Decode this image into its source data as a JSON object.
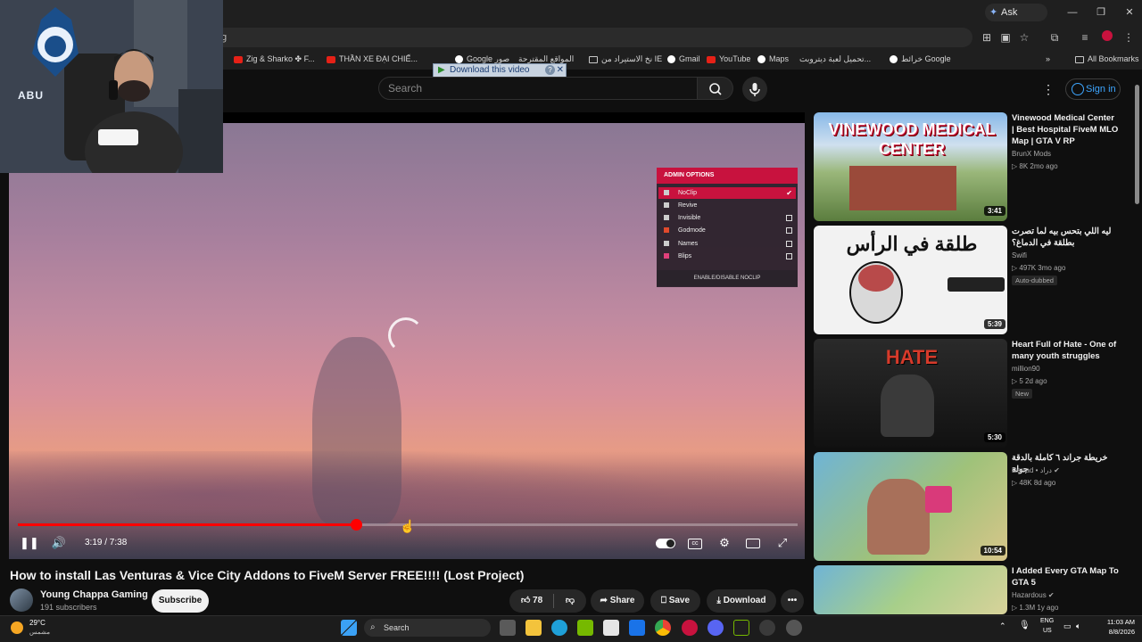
{
  "browser": {
    "ask_gemini": "Ask Gemini",
    "address_fragment": "g",
    "bookmarks": [
      "Zig & Sharko ✤ F...",
      "THẦN XE ĐẠI CHIẾ...",
      "Google صور",
      "المواقع المقترحة",
      "تحميل لعبة ديتروبت...",
      "Maps",
      "YouTube",
      "Gmail",
      "نخ الاستيراد من IE",
      "خرائط Google",
      "All Bookmarks"
    ],
    "download_bar": "Download this video"
  },
  "youtube": {
    "search_placeholder": "Search",
    "signin_label": "Sign in"
  },
  "video": {
    "admin_title": "ADMIN OPTIONS",
    "admin_items": [
      "NoClip",
      "Revive",
      "Invisible",
      "Godmode",
      "Names",
      "Blips"
    ],
    "admin_button": "ENABLE/DISABLE NOCLIP",
    "time": "3:19 / 7:38",
    "progress_fraction": 0.434,
    "title": "How to install Las Venturas & Vice City Addons to FiveM Server FREE!!!! (Lost Project)"
  },
  "channel": {
    "name": "Young Chappa Gaming",
    "subscribers": "191 subscribers",
    "subscribe_label": "Subscribe"
  },
  "actions": {
    "likes": "78",
    "share": "Share",
    "save": "Save",
    "download": "Download"
  },
  "recommendations": [
    {
      "title": "Vinewood Medical Center | Best Hospital FiveM MLO Map | GTA V RP",
      "channel": "BrunX Mods",
      "meta": "8K  2mo ago",
      "duration": "3:41",
      "badge": ""
    },
    {
      "title": "ليه اللي بتحس بيه لما تصرت بطلقة في الدماغ؟",
      "channel": "Swifi",
      "meta": "497K  3mo ago",
      "duration": "5:39",
      "badge": "Auto-dubbed"
    },
    {
      "title": "Heart Full of Hate - One of many youth struggles",
      "channel": "million90",
      "meta": "5  2d ago",
      "duration": "5:30",
      "badge": "New"
    },
    {
      "title": "خريطة جراند ٦ كاملة بالدقة جولة",
      "channel": "Derrad • دراد",
      "meta": "48K  8d ago",
      "duration": "10:54",
      "badge": ""
    },
    {
      "title": "I Added Every GTA Map To GTA 5",
      "channel": "Hazardous",
      "meta": "1.3M  1y ago",
      "duration": "",
      "badge": ""
    }
  ],
  "thumb_texts": {
    "vinewood": "VINEWOOD MEDICAL CENTER",
    "arabic": "طلقة في الرأس",
    "hate": "HATE"
  },
  "taskbar": {
    "temperature": "29°C",
    "condition": "مشمس",
    "search": "Search",
    "lang1": "ENG",
    "lang2": "US",
    "time": "11:03 AM",
    "date": "8/8/2026"
  },
  "webcam_logo_text": "ABU"
}
